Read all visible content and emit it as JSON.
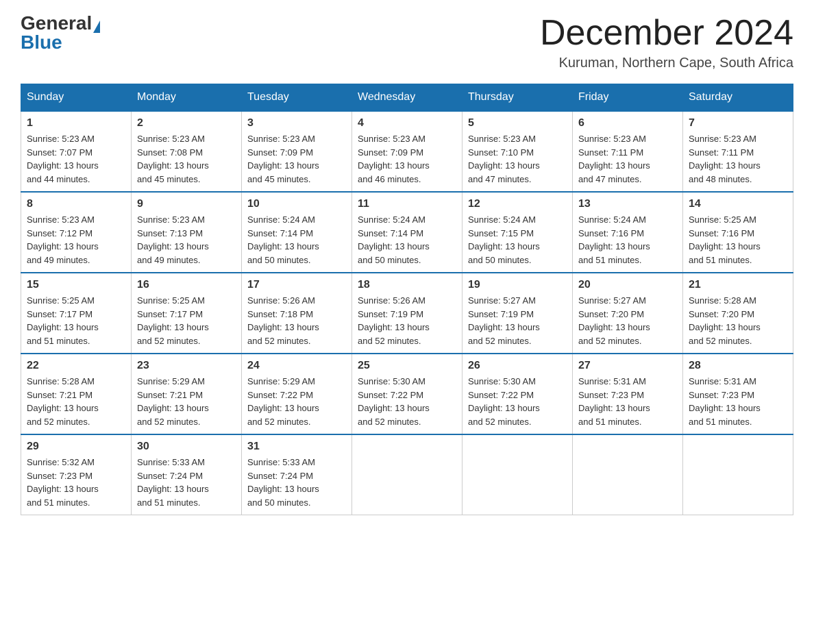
{
  "header": {
    "logo_general": "General",
    "logo_blue": "Blue",
    "month_title": "December 2024",
    "location": "Kuruman, Northern Cape, South Africa"
  },
  "days_of_week": [
    "Sunday",
    "Monday",
    "Tuesday",
    "Wednesday",
    "Thursday",
    "Friday",
    "Saturday"
  ],
  "weeks": [
    [
      {
        "day": 1,
        "sunrise": "5:23 AM",
        "sunset": "7:07 PM",
        "daylight": "13 hours and 44 minutes."
      },
      {
        "day": 2,
        "sunrise": "5:23 AM",
        "sunset": "7:08 PM",
        "daylight": "13 hours and 45 minutes."
      },
      {
        "day": 3,
        "sunrise": "5:23 AM",
        "sunset": "7:09 PM",
        "daylight": "13 hours and 45 minutes."
      },
      {
        "day": 4,
        "sunrise": "5:23 AM",
        "sunset": "7:09 PM",
        "daylight": "13 hours and 46 minutes."
      },
      {
        "day": 5,
        "sunrise": "5:23 AM",
        "sunset": "7:10 PM",
        "daylight": "13 hours and 47 minutes."
      },
      {
        "day": 6,
        "sunrise": "5:23 AM",
        "sunset": "7:11 PM",
        "daylight": "13 hours and 47 minutes."
      },
      {
        "day": 7,
        "sunrise": "5:23 AM",
        "sunset": "7:11 PM",
        "daylight": "13 hours and 48 minutes."
      }
    ],
    [
      {
        "day": 8,
        "sunrise": "5:23 AM",
        "sunset": "7:12 PM",
        "daylight": "13 hours and 49 minutes."
      },
      {
        "day": 9,
        "sunrise": "5:23 AM",
        "sunset": "7:13 PM",
        "daylight": "13 hours and 49 minutes."
      },
      {
        "day": 10,
        "sunrise": "5:24 AM",
        "sunset": "7:14 PM",
        "daylight": "13 hours and 50 minutes."
      },
      {
        "day": 11,
        "sunrise": "5:24 AM",
        "sunset": "7:14 PM",
        "daylight": "13 hours and 50 minutes."
      },
      {
        "day": 12,
        "sunrise": "5:24 AM",
        "sunset": "7:15 PM",
        "daylight": "13 hours and 50 minutes."
      },
      {
        "day": 13,
        "sunrise": "5:24 AM",
        "sunset": "7:16 PM",
        "daylight": "13 hours and 51 minutes."
      },
      {
        "day": 14,
        "sunrise": "5:25 AM",
        "sunset": "7:16 PM",
        "daylight": "13 hours and 51 minutes."
      }
    ],
    [
      {
        "day": 15,
        "sunrise": "5:25 AM",
        "sunset": "7:17 PM",
        "daylight": "13 hours and 51 minutes."
      },
      {
        "day": 16,
        "sunrise": "5:25 AM",
        "sunset": "7:17 PM",
        "daylight": "13 hours and 52 minutes."
      },
      {
        "day": 17,
        "sunrise": "5:26 AM",
        "sunset": "7:18 PM",
        "daylight": "13 hours and 52 minutes."
      },
      {
        "day": 18,
        "sunrise": "5:26 AM",
        "sunset": "7:19 PM",
        "daylight": "13 hours and 52 minutes."
      },
      {
        "day": 19,
        "sunrise": "5:27 AM",
        "sunset": "7:19 PM",
        "daylight": "13 hours and 52 minutes."
      },
      {
        "day": 20,
        "sunrise": "5:27 AM",
        "sunset": "7:20 PM",
        "daylight": "13 hours and 52 minutes."
      },
      {
        "day": 21,
        "sunrise": "5:28 AM",
        "sunset": "7:20 PM",
        "daylight": "13 hours and 52 minutes."
      }
    ],
    [
      {
        "day": 22,
        "sunrise": "5:28 AM",
        "sunset": "7:21 PM",
        "daylight": "13 hours and 52 minutes."
      },
      {
        "day": 23,
        "sunrise": "5:29 AM",
        "sunset": "7:21 PM",
        "daylight": "13 hours and 52 minutes."
      },
      {
        "day": 24,
        "sunrise": "5:29 AM",
        "sunset": "7:22 PM",
        "daylight": "13 hours and 52 minutes."
      },
      {
        "day": 25,
        "sunrise": "5:30 AM",
        "sunset": "7:22 PM",
        "daylight": "13 hours and 52 minutes."
      },
      {
        "day": 26,
        "sunrise": "5:30 AM",
        "sunset": "7:22 PM",
        "daylight": "13 hours and 52 minutes."
      },
      {
        "day": 27,
        "sunrise": "5:31 AM",
        "sunset": "7:23 PM",
        "daylight": "13 hours and 51 minutes."
      },
      {
        "day": 28,
        "sunrise": "5:31 AM",
        "sunset": "7:23 PM",
        "daylight": "13 hours and 51 minutes."
      }
    ],
    [
      {
        "day": 29,
        "sunrise": "5:32 AM",
        "sunset": "7:23 PM",
        "daylight": "13 hours and 51 minutes."
      },
      {
        "day": 30,
        "sunrise": "5:33 AM",
        "sunset": "7:24 PM",
        "daylight": "13 hours and 51 minutes."
      },
      {
        "day": 31,
        "sunrise": "5:33 AM",
        "sunset": "7:24 PM",
        "daylight": "13 hours and 50 minutes."
      },
      null,
      null,
      null,
      null
    ]
  ],
  "labels": {
    "sunrise": "Sunrise:",
    "sunset": "Sunset:",
    "daylight": "Daylight:"
  }
}
